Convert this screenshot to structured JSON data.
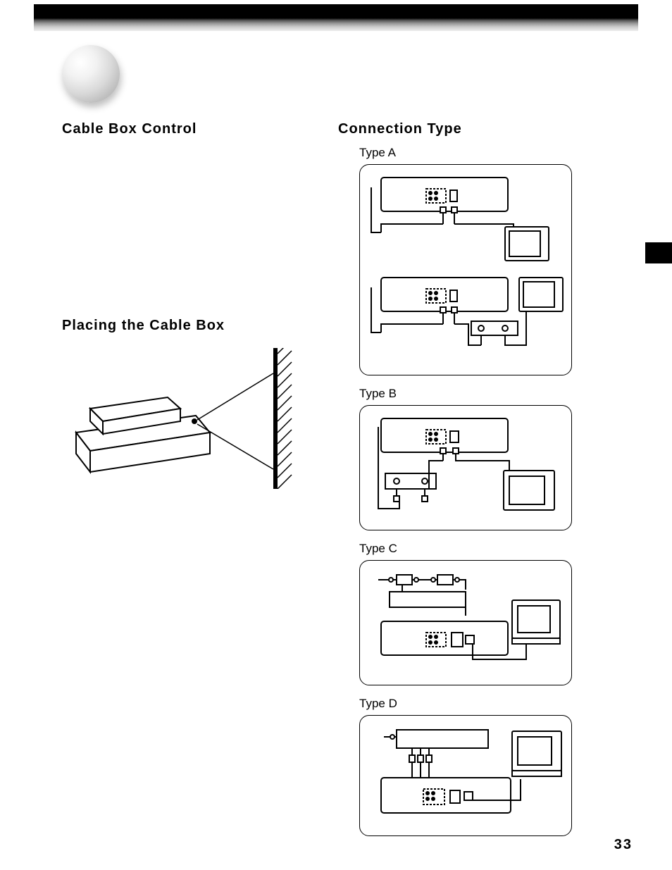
{
  "headings": {
    "cable_box_control": "Cable Box Control",
    "placing_cable_box": "Placing the Cable Box",
    "connection_type": "Connection Type"
  },
  "types": {
    "a": "Type A",
    "b": "Type B",
    "c": "Type C",
    "d": "Type D"
  },
  "page_number": "33"
}
